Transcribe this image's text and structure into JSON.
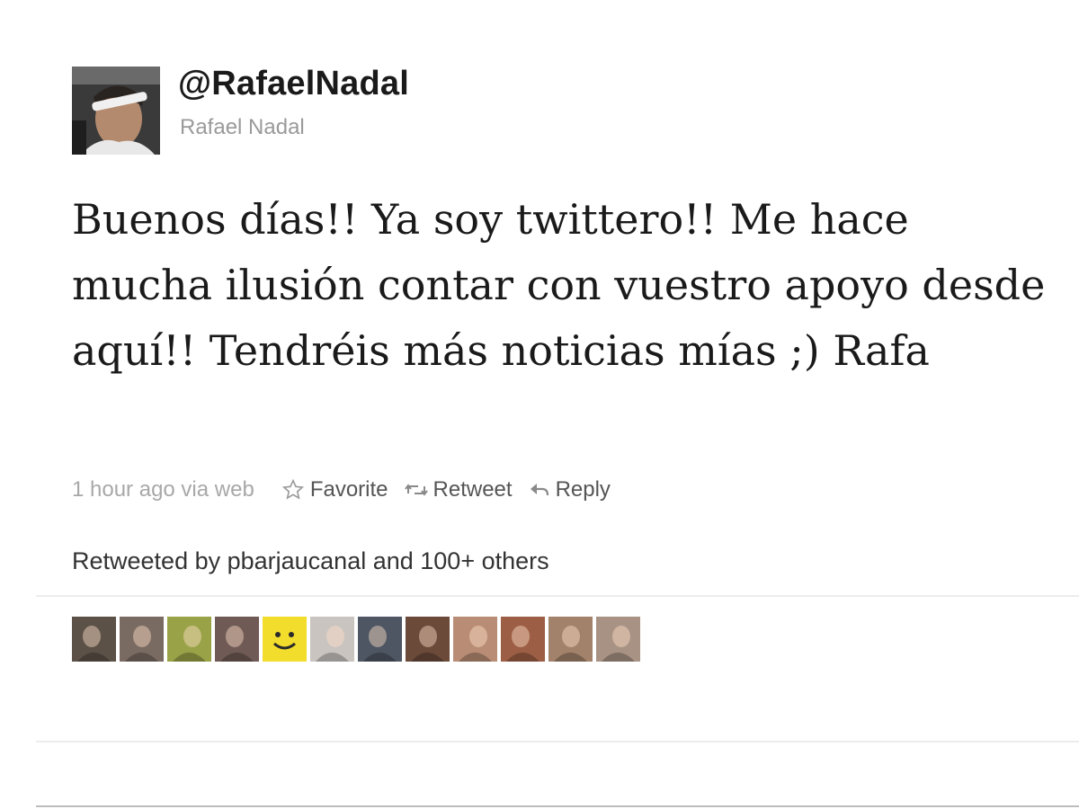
{
  "user": {
    "handle": "@RafaelNadal",
    "name": "Rafael Nadal",
    "avatar_icon": "profile-photo-icon"
  },
  "tweet": {
    "text": "Buenos días!! Ya soy twittero!! Me hace mucha ilusión contar con vuestro apoyo desde aquí!! Tendréis más noticias mías ;) Rafa"
  },
  "meta": {
    "timestamp": "1 hour ago via web",
    "favorite_label": "Favorite",
    "retweet_label": "Retweet",
    "reply_label": "Reply"
  },
  "retweets": {
    "summary": "Retweeted by pbarjaucanal and 100+ others",
    "avatars": [
      {
        "icon": "retweeter-avatar-icon",
        "color": "#5b5147"
      },
      {
        "icon": "retweeter-avatar-icon",
        "color": "#7a6b62"
      },
      {
        "icon": "retweeter-avatar-icon",
        "color": "#9aa247"
      },
      {
        "icon": "retweeter-avatar-icon",
        "color": "#6f5a55"
      },
      {
        "icon": "smiley-avatar-icon",
        "color": "#f2dc2c"
      },
      {
        "icon": "retweeter-avatar-icon",
        "color": "#c9c4c0"
      },
      {
        "icon": "retweeter-avatar-icon",
        "color": "#4e5663"
      },
      {
        "icon": "retweeter-avatar-icon",
        "color": "#6b4a3a"
      },
      {
        "icon": "retweeter-avatar-icon",
        "color": "#b98d75"
      },
      {
        "icon": "retweeter-avatar-icon",
        "color": "#9c5f45"
      },
      {
        "icon": "retweeter-avatar-icon",
        "color": "#a2826a"
      },
      {
        "icon": "retweeter-avatar-icon",
        "color": "#a89284"
      }
    ]
  },
  "colors": {
    "text": "#1a1a1a",
    "muted": "#a8a8a8",
    "action": "#555555",
    "divider": "#ececec"
  }
}
